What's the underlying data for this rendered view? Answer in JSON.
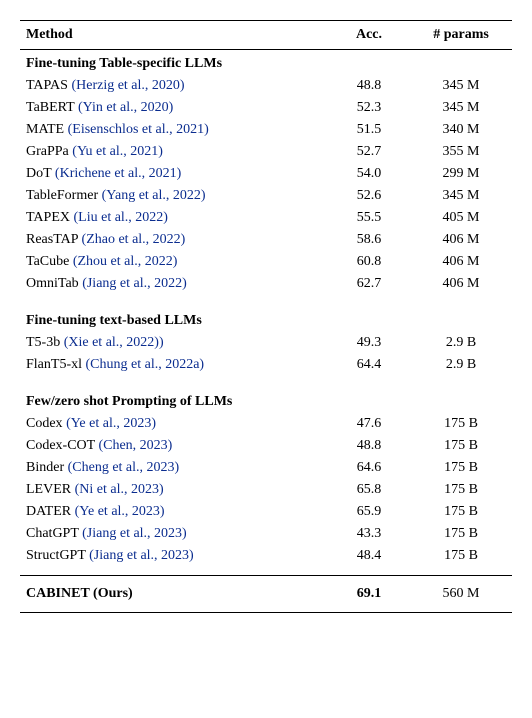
{
  "chart_data": {
    "type": "table",
    "columns": [
      "Method",
      "Acc.",
      "# params"
    ],
    "sections": [
      {
        "title": "Fine-tuning Table-specific LLMs",
        "rows": [
          {
            "method": "TAPAS",
            "cite": "(Herzig et al., 2020)",
            "acc": "48.8",
            "params": "345 M"
          },
          {
            "method": "TaBERT",
            "cite": "(Yin et al., 2020)",
            "acc": "52.3",
            "params": "345 M"
          },
          {
            "method": "MATE",
            "cite": "(Eisenschlos et al., 2021)",
            "acc": "51.5",
            "params": "340 M"
          },
          {
            "method": "GraPPa",
            "cite": "(Yu et al., 2021)",
            "acc": "52.7",
            "params": "355 M"
          },
          {
            "method": "DoT",
            "cite": "(Krichene et al., 2021)",
            "acc": "54.0",
            "params": "299 M"
          },
          {
            "method": "TableFormer",
            "cite": "(Yang et al., 2022)",
            "acc": "52.6",
            "params": "345 M"
          },
          {
            "method": "TAPEX",
            "cite": "(Liu et al., 2022)",
            "acc": "55.5",
            "params": "405 M"
          },
          {
            "method": "ReasTAP",
            "cite": "(Zhao et al., 2022)",
            "acc": "58.6",
            "params": "406 M"
          },
          {
            "method": "TaCube",
            "cite": "(Zhou et al., 2022)",
            "acc": "60.8",
            "params": "406 M"
          },
          {
            "method": "OmniTab",
            "cite": "(Jiang et al., 2022)",
            "acc": "62.7",
            "params": "406 M"
          }
        ]
      },
      {
        "title": "Fine-tuning text-based LLMs",
        "rows": [
          {
            "method": "T5-3b",
            "cite": "(Xie et al., 2022))",
            "acc": "49.3",
            "params": "2.9 B"
          },
          {
            "method": "FlanT5-xl",
            "cite": "(Chung et al., 2022a)",
            "acc": "64.4",
            "params": "2.9 B"
          }
        ]
      },
      {
        "title": "Few/zero shot Prompting of LLMs",
        "rows": [
          {
            "method": "Codex",
            "cite": "(Ye et al., 2023)",
            "acc": "47.6",
            "params": "175 B"
          },
          {
            "method": "Codex-COT",
            "cite": "(Chen, 2023)",
            "acc": "48.8",
            "params": "175 B"
          },
          {
            "method": "Binder",
            "cite": "(Cheng et al., 2023)",
            "acc": "64.6",
            "params": "175 B"
          },
          {
            "method": "LEVER",
            "cite": "(Ni et al., 2023)",
            "acc": "65.8",
            "params": "175 B"
          },
          {
            "method": "DATER",
            "cite": "(Ye et al., 2023)",
            "acc": "65.9",
            "params": "175 B"
          },
          {
            "method": "ChatGPT",
            "cite": "(Jiang et al., 2023)",
            "acc": "43.3",
            "params": "175 B"
          },
          {
            "method": "StructGPT",
            "cite": "(Jiang et al., 2023)",
            "acc": "48.4",
            "params": "175 B"
          }
        ]
      }
    ],
    "ours": {
      "method": "CABINET (Ours)",
      "acc": "69.1",
      "params": "560 M"
    }
  }
}
